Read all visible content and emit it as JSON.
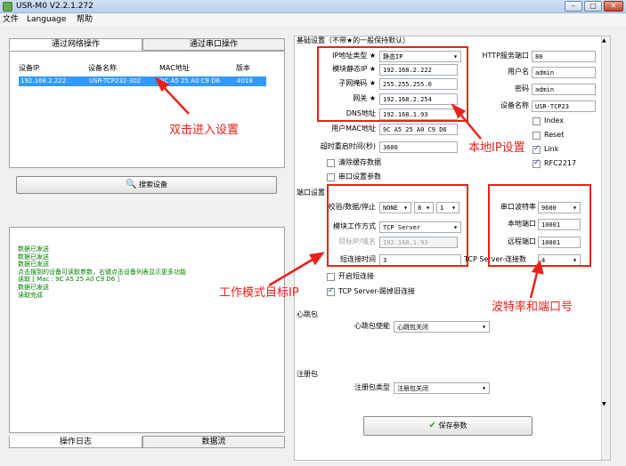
{
  "window": {
    "title": "USR-M0 V2.2.1.272",
    "minimize": "–",
    "maximize": "□",
    "close": "✕"
  },
  "menu": {
    "file": "文件",
    "language": "Language",
    "help": "帮助"
  },
  "left": {
    "tabs": {
      "network": "通过网络操作",
      "serial": "通过串口操作"
    },
    "columns": {
      "ip": "设备IP",
      "name": "设备名称",
      "mac": "MAC地址",
      "version": "版本"
    },
    "row": {
      "ip": "192.168.2.222",
      "name": "USR-TCP232-302",
      "mac": "9C A5 25 A0 C9 D6",
      "version": "4018"
    },
    "search": "搜索设备",
    "log": [
      "数据已发送",
      "数据已发送",
      "数据已发送",
      "点击搜到的设备可读取参数，右键点击设备列表显示更多功能",
      "读取 [ Mac : 9C A5 25 A0 C9 D6 ]",
      "数据已发送",
      "读取完成"
    ],
    "bottom_tabs": {
      "log": "操作日志",
      "data": "数据流"
    }
  },
  "right": {
    "basic_title": "基础设置（不带★的一般保持默认）",
    "ip_type": {
      "label": "IP地址类型 ★",
      "value": "静态IP"
    },
    "static_ip": {
      "label": "模块静态IP ★",
      "value": "192.168.2.222"
    },
    "mask": {
      "label": "子网掩码 ★",
      "value": "255.255.255.0"
    },
    "gateway": {
      "label": "网关 ★",
      "value": "192.168.2.254"
    },
    "dns": {
      "label": "DNS地址",
      "value": "192.168.1.93"
    },
    "mac": {
      "label": "用户MAC地址",
      "value": "9C A5 25 A0 C9 D6"
    },
    "timeout": {
      "label": "超时重启时间(秒)",
      "value": "3600"
    },
    "clear_cache": "清除缓存数据",
    "serial_params": "串口设置参数",
    "http_port": {
      "label": "HTTP服务端口",
      "value": "80"
    },
    "username": {
      "label": "用户名",
      "value": "admin"
    },
    "password": {
      "label": "密码",
      "value": "admin"
    },
    "device_name": {
      "label": "设备名称",
      "value": "USR-TCP23"
    },
    "index": "Index",
    "reset": "Reset",
    "link": "Link",
    "rfc": "RFC2217",
    "port_title": "端口设置",
    "check": {
      "label": "校验/数据/停止",
      "parity": "NONE",
      "data": "8",
      "stop": "1"
    },
    "mode": {
      "label": "模块工作方式",
      "value": "TCP Server"
    },
    "target_ip": {
      "label": "目标IP/域名",
      "value": "192.168.1.93"
    },
    "short_conn": {
      "label": "短连接时间",
      "value": "3"
    },
    "clients_label": "TCP Server-连接数",
    "clients_value": "4",
    "reconnect": "开启短连接",
    "kick": "TCP Server-踢掉旧连接",
    "baud": {
      "label": "串口波特率",
      "value": "9600"
    },
    "local_port": {
      "label": "本地端口",
      "value": "10001"
    },
    "remote_port": {
      "label": "远程端口",
      "value": "10001"
    },
    "heartbeat_title": "心跳包",
    "heartbeat": {
      "label": "心跳包使能",
      "value": "心跳包关闭"
    },
    "register_title": "注册包",
    "register": {
      "label": "注册包类型",
      "value": "注册包关闭"
    },
    "save": "保存参数"
  },
  "annotations": {
    "dbl": "双击进入设置",
    "local_ip": "本地IP设置",
    "mode_target": "工作模式目标IP",
    "baud_port": "波特率和端口号"
  },
  "colors": {
    "annotation": "#e8221c",
    "selection": "#3399ff",
    "log_text": "#008000"
  }
}
